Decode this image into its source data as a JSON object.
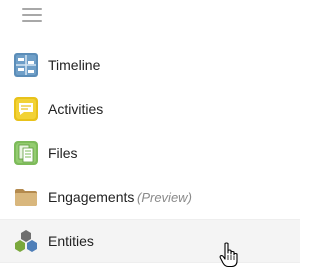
{
  "menu": {
    "icon": "hamburger-menu-icon"
  },
  "nav": {
    "items": [
      {
        "label": "Timeline",
        "icon": "timeline-icon",
        "color": "#5b8db8"
      },
      {
        "label": "Activities",
        "icon": "activities-icon",
        "color": "#e8c21a"
      },
      {
        "label": "Files",
        "icon": "files-icon",
        "color": "#7dbb5a"
      },
      {
        "label": "Engagements",
        "tag": "(Preview)",
        "icon": "folder-icon",
        "color": "#c9a66b"
      },
      {
        "label": "Entities",
        "icon": "entities-icon",
        "color": "#6f8f3a",
        "hovered": true
      }
    ]
  },
  "cursor": "hand-pointer-cursor"
}
